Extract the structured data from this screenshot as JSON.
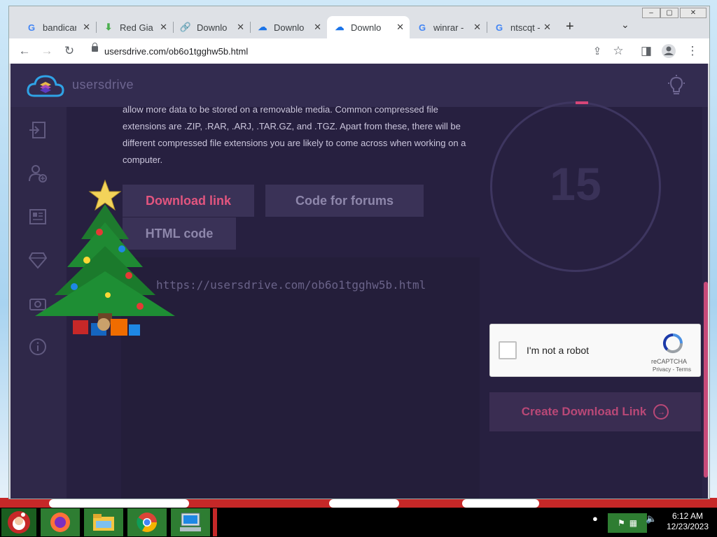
{
  "browser": {
    "tabs": [
      {
        "label": "bandicar",
        "icon": "google-g-icon"
      },
      {
        "label": "Red Gian",
        "icon": "download-arrow-icon"
      },
      {
        "label": "Downlo",
        "icon": "link-icon"
      },
      {
        "label": "Downlo",
        "icon": "cloud-icon"
      },
      {
        "label": "Downlo",
        "icon": "cloud-icon",
        "active": true
      },
      {
        "label": "winrar -",
        "icon": "google-g-icon"
      },
      {
        "label": "ntscqt -",
        "icon": "google-g-icon"
      }
    ],
    "url": "usersdrive.com/ob6o1tgghw5b.html"
  },
  "site": {
    "brand": "usersdrive",
    "paragraph": "allow more data to be stored on a removable media. Common compressed file extensions are .ZIP, .RAR, .ARJ, .TAR.GZ, and .TGZ. Apart from these, there will be different compressed file extensions you are likely to come across when working on a computer.",
    "tabs": {
      "download_link": "Download link",
      "code_forums": "Code for forums",
      "html_code": "HTML code"
    },
    "link_text": "https://usersdrive.com/ob6o1tgghw5b.html",
    "countdown": "15",
    "captcha": {
      "label": "I'm not a robot",
      "brand": "reCAPTCHA",
      "terms": "Privacy - Terms"
    },
    "create_button": "Create Download Link",
    "colors": {
      "accent": "#d54678",
      "background": "#2b2446"
    }
  },
  "taskbar": {
    "time": "6:12 AM",
    "date": "12/23/2023"
  }
}
